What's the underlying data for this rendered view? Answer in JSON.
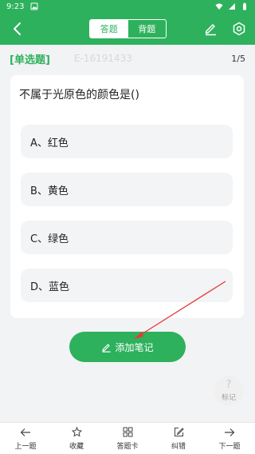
{
  "status_bar": {
    "time": "9:23"
  },
  "tabs": [
    {
      "label": "答题",
      "active": true
    },
    {
      "label": "背题",
      "active": false
    }
  ],
  "question": {
    "type_label": "[单选题]",
    "id": "E-16191433",
    "progress": "1/5",
    "text": "不属于光原色的颜色是()",
    "options": [
      "A、红色",
      "B、黄色",
      "C、绿色",
      "D、蓝色"
    ]
  },
  "add_note_label": "添加笔记",
  "mark_label": "标记",
  "bottom_nav": [
    {
      "label": "上一题",
      "icon": "arrow-left-icon"
    },
    {
      "label": "收藏",
      "icon": "star-icon"
    },
    {
      "label": "答题卡",
      "icon": "grid-icon"
    },
    {
      "label": "纠错",
      "icon": "edit-icon"
    },
    {
      "label": "下一题",
      "icon": "arrow-right-icon"
    }
  ],
  "colors": {
    "brand": "#2eb15d",
    "annotation": "#e53935"
  }
}
